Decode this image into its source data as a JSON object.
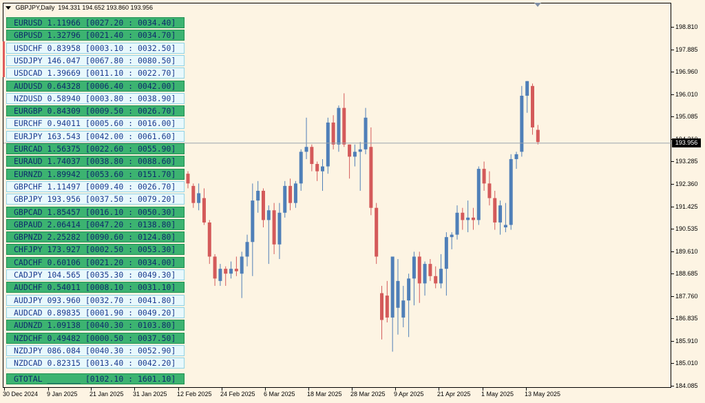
{
  "window": {
    "symbol_label": "GBPJPY,Daily",
    "ohlc": "194.331 194.652 193.860 193.956"
  },
  "panel_rows": [
    {
      "text": "EURUSD 1.11966 [0027.20 : 0034.40]",
      "style": "green"
    },
    {
      "text": "GBPUSD 1.32796 [0021.40 : 0034.70]",
      "style": "green"
    },
    {
      "text": "USDCHF 0.83958 [0003.10 : 0032.50]",
      "style": "light"
    },
    {
      "text": "USDJPY 146.047 [0067.80 : 0080.50]",
      "style": "light"
    },
    {
      "text": "USDCAD 1.39669 [0011.10 : 0022.70]",
      "style": "light"
    },
    {
      "text": "AUDUSD 0.64328 [0006.40 : 0042.00]",
      "style": "green"
    },
    {
      "text": "NZDUSD 0.58940 [0003.80 : 0038.90]",
      "style": "light"
    },
    {
      "text": "EURGBP 0.84309 [0009.50 : 0026.70]",
      "style": "green"
    },
    {
      "text": "EURCHF 0.94011 [0005.60 : 0016.00]",
      "style": "light"
    },
    {
      "text": "EURJPY 163.543 [0042.00 : 0061.60]",
      "style": "light"
    },
    {
      "text": "EURCAD 1.56375 [0022.60 : 0055.90]",
      "style": "green"
    },
    {
      "text": "EURAUD 1.74037 [0038.80 : 0088.60]",
      "style": "green"
    },
    {
      "text": "EURNZD 1.89942 [0053.60 : 0151.70]",
      "style": "green"
    },
    {
      "text": "GBPCHF 1.11497 [0009.40 : 0026.70]",
      "style": "light"
    },
    {
      "text": "GBPJPY 193.956 [0037.50 : 0079.20]",
      "style": "light"
    },
    {
      "text": "GBPCAD 1.85457 [0016.10 : 0050.30]",
      "style": "green"
    },
    {
      "text": "GBPAUD 2.06414 [0047.20 : 0138.80]",
      "style": "green"
    },
    {
      "text": "GBPNZD 2.25282 [0090.60 : 0124.80]",
      "style": "green"
    },
    {
      "text": "CHFJPY 173.927 [0002.50 : 0053.30]",
      "style": "green"
    },
    {
      "text": "CADCHF 0.60106 [0021.20 : 0034.00]",
      "style": "green"
    },
    {
      "text": "CADJPY 104.565 [0035.30 : 0049.30]",
      "style": "light"
    },
    {
      "text": "AUDCHF 0.54011 [0008.10 : 0031.10]",
      "style": "green"
    },
    {
      "text": "AUDJPY 093.960 [0032.70 : 0041.80]",
      "style": "light"
    },
    {
      "text": "AUDCAD 0.89835 [0001.90 : 0049.20]",
      "style": "light"
    },
    {
      "text": "AUDNZD 1.09138 [0040.30 : 0103.80]",
      "style": "green"
    },
    {
      "text": "NZDCHF 0.49482 [0000.50 : 0037.50]",
      "style": "green"
    },
    {
      "text": "NZDJPY 086.084 [0040.30 : 0052.90]",
      "style": "light"
    },
    {
      "text": "NZDCAD 0.82315 [0013.40 : 0042.20]",
      "style": "light"
    }
  ],
  "total_row": {
    "text": "GTOTAL _______ [0102.10 : 1601.10]",
    "style": "green"
  },
  "price_axis_labels": [
    "198.810",
    "197.885",
    "196.960",
    "196.010",
    "195.085",
    "194.210",
    "193.285",
    "192.360",
    "191.425",
    "190.535",
    "189.610",
    "188.685",
    "187.760",
    "186.835",
    "185.910",
    "185.010",
    "184.085"
  ],
  "current_price": "193.956",
  "time_axis_labels": [
    "30 Dec 2024",
    "9 Jan 2025",
    "21 Jan 2025",
    "31 Jan 2025",
    "12 Feb 2025",
    "24 Feb 2025",
    "6 Mar 2025",
    "18 Mar 2025",
    "28 Mar 2025",
    "9 Apr 2025",
    "21 Apr 2025",
    "1 May 2025",
    "13 May 2025"
  ],
  "colors": {
    "bull": "#4f7fb8",
    "bear": "#d45a5a",
    "background": "#fdf4e3",
    "panel_green": "#3cb371",
    "panel_light": "#e8f8fc"
  },
  "chart_data": {
    "type": "candlestick",
    "y_range": [
      184.085,
      198.81
    ],
    "candles": [
      {
        "o": 192.7,
        "h": 192.8,
        "l": 192.1,
        "c": 192.3
      },
      {
        "o": 192.2,
        "h": 192.3,
        "l": 191.3,
        "c": 191.5
      },
      {
        "o": 191.5,
        "h": 192.3,
        "l": 191.2,
        "c": 191.9
      },
      {
        "o": 191.7,
        "h": 192.1,
        "l": 190.6,
        "c": 190.7
      },
      {
        "o": 190.7,
        "h": 190.8,
        "l": 189.0,
        "c": 189.3
      },
      {
        "o": 189.3,
        "h": 189.4,
        "l": 188.1,
        "c": 188.4
      },
      {
        "o": 188.3,
        "h": 189.0,
        "l": 188.1,
        "c": 188.8
      },
      {
        "o": 188.8,
        "h": 188.9,
        "l": 188.1,
        "c": 188.6
      },
      {
        "o": 188.6,
        "h": 189.1,
        "l": 188.4,
        "c": 188.8
      },
      {
        "o": 188.8,
        "h": 189.3,
        "l": 188.5,
        "c": 188.7
      },
      {
        "o": 188.6,
        "h": 189.5,
        "l": 187.6,
        "c": 189.3
      },
      {
        "o": 189.3,
        "h": 190.2,
        "l": 188.9,
        "c": 189.9
      },
      {
        "o": 189.9,
        "h": 192.3,
        "l": 188.5,
        "c": 191.6
      },
      {
        "o": 191.6,
        "h": 192.4,
        "l": 191.1,
        "c": 192.0
      },
      {
        "o": 192.0,
        "h": 192.1,
        "l": 190.5,
        "c": 190.8
      },
      {
        "o": 190.8,
        "h": 191.4,
        "l": 189.0,
        "c": 191.2
      },
      {
        "o": 191.2,
        "h": 191.5,
        "l": 189.4,
        "c": 189.8
      },
      {
        "o": 189.8,
        "h": 191.5,
        "l": 189.2,
        "c": 191.1
      },
      {
        "o": 191.1,
        "h": 192.4,
        "l": 190.9,
        "c": 192.2
      },
      {
        "o": 192.2,
        "h": 192.5,
        "l": 191.2,
        "c": 191.5
      },
      {
        "o": 191.5,
        "h": 192.4,
        "l": 191.3,
        "c": 192.3
      },
      {
        "o": 192.3,
        "h": 193.7,
        "l": 192.0,
        "c": 193.6
      },
      {
        "o": 193.6,
        "h": 195.0,
        "l": 193.3,
        "c": 193.8
      },
      {
        "o": 193.8,
        "h": 193.9,
        "l": 192.8,
        "c": 193.1
      },
      {
        "o": 193.1,
        "h": 193.2,
        "l": 192.4,
        "c": 192.8
      },
      {
        "o": 192.8,
        "h": 193.3,
        "l": 192.0,
        "c": 193.0
      },
      {
        "o": 193.0,
        "h": 195.0,
        "l": 192.7,
        "c": 194.8
      },
      {
        "o": 194.8,
        "h": 195.1,
        "l": 193.7,
        "c": 193.9
      },
      {
        "o": 193.9,
        "h": 195.5,
        "l": 193.6,
        "c": 195.4
      },
      {
        "o": 195.4,
        "h": 196.0,
        "l": 193.8,
        "c": 193.9
      },
      {
        "o": 193.9,
        "h": 193.9,
        "l": 192.5,
        "c": 193.4
      },
      {
        "o": 193.4,
        "h": 193.9,
        "l": 193.0,
        "c": 193.6
      },
      {
        "o": 193.6,
        "h": 194.0,
        "l": 192.0,
        "c": 193.7
      },
      {
        "o": 193.7,
        "h": 195.4,
        "l": 193.5,
        "c": 195.0
      },
      {
        "o": 193.8,
        "h": 194.6,
        "l": 191.0,
        "c": 191.3
      },
      {
        "o": 191.3,
        "h": 191.5,
        "l": 189.0,
        "c": 189.3
      },
      {
        "o": 187.8,
        "h": 188.1,
        "l": 185.9,
        "c": 186.7
      },
      {
        "o": 187.7,
        "h": 188.3,
        "l": 186.6,
        "c": 186.8
      },
      {
        "o": 186.8,
        "h": 189.3,
        "l": 185.4,
        "c": 189.3
      },
      {
        "o": 187.2,
        "h": 189.2,
        "l": 186.1,
        "c": 188.3
      },
      {
        "o": 186.8,
        "h": 188.1,
        "l": 186.4,
        "c": 187.5
      },
      {
        "o": 187.5,
        "h": 188.6,
        "l": 186.0,
        "c": 188.4
      },
      {
        "o": 188.4,
        "h": 189.5,
        "l": 187.3,
        "c": 189.3
      },
      {
        "o": 189.3,
        "h": 189.5,
        "l": 187.4,
        "c": 188.2
      },
      {
        "o": 188.2,
        "h": 189.1,
        "l": 187.7,
        "c": 189.0
      },
      {
        "o": 189.0,
        "h": 189.2,
        "l": 188.3,
        "c": 188.5
      },
      {
        "o": 188.5,
        "h": 188.9,
        "l": 188.0,
        "c": 188.2
      },
      {
        "o": 188.2,
        "h": 189.4,
        "l": 188.0,
        "c": 188.8
      },
      {
        "o": 188.8,
        "h": 190.3,
        "l": 187.7,
        "c": 190.1
      },
      {
        "o": 190.1,
        "h": 190.3,
        "l": 189.6,
        "c": 190.2
      },
      {
        "o": 190.2,
        "h": 191.4,
        "l": 190.0,
        "c": 191.1
      },
      {
        "o": 191.1,
        "h": 191.3,
        "l": 190.4,
        "c": 190.8
      },
      {
        "o": 190.8,
        "h": 191.6,
        "l": 190.3,
        "c": 190.9
      },
      {
        "o": 190.9,
        "h": 191.3,
        "l": 190.4,
        "c": 190.8
      },
      {
        "o": 190.8,
        "h": 193.0,
        "l": 190.6,
        "c": 192.9
      },
      {
        "o": 192.9,
        "h": 193.2,
        "l": 192.0,
        "c": 192.3
      },
      {
        "o": 192.3,
        "h": 192.8,
        "l": 191.4,
        "c": 191.7
      },
      {
        "o": 191.7,
        "h": 192.0,
        "l": 190.4,
        "c": 190.7
      },
      {
        "o": 190.7,
        "h": 191.6,
        "l": 190.2,
        "c": 191.4
      },
      {
        "o": 190.5,
        "h": 191.5,
        "l": 190.3,
        "c": 190.6
      },
      {
        "o": 190.6,
        "h": 193.5,
        "l": 190.4,
        "c": 193.3
      },
      {
        "o": 193.3,
        "h": 193.6,
        "l": 192.9,
        "c": 193.5
      },
      {
        "o": 193.6,
        "h": 196.3,
        "l": 193.4,
        "c": 195.9
      },
      {
        "o": 195.9,
        "h": 196.5,
        "l": 195.2,
        "c": 196.5
      },
      {
        "o": 196.3,
        "h": 196.4,
        "l": 194.3,
        "c": 194.6
      },
      {
        "o": 194.5,
        "h": 194.7,
        "l": 193.9,
        "c": 194.0
      }
    ]
  }
}
